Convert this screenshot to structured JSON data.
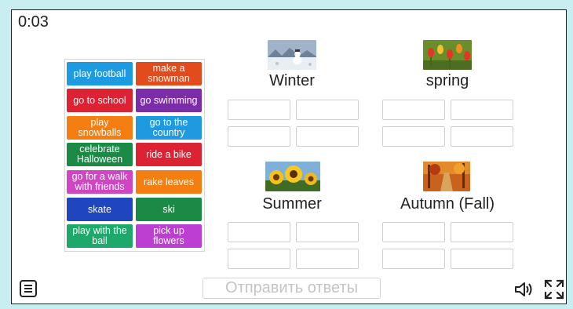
{
  "timer": "0:03",
  "cards": [
    {
      "label": "play football",
      "color": "#1e9be0"
    },
    {
      "label": "make a snowman",
      "color": "#e24b1c"
    },
    {
      "label": "go to school",
      "color": "#dc2334"
    },
    {
      "label": "go swimming",
      "color": "#7b2da8"
    },
    {
      "label": "play snowballs",
      "color": "#f57e12"
    },
    {
      "label": "go to the country",
      "color": "#1e9be0"
    },
    {
      "label": "celebrate Halloween",
      "color": "#1c8a47"
    },
    {
      "label": "ride a bike",
      "color": "#dc2334"
    },
    {
      "label": "go for a walk with friends",
      "color": "#cf45c3"
    },
    {
      "label": "rake leaves",
      "color": "#f57e12"
    },
    {
      "label": "skate",
      "color": "#2046bf"
    },
    {
      "label": "ski",
      "color": "#1c8a47"
    },
    {
      "label": "play with the ball",
      "color": "#1ea86a"
    },
    {
      "label": "pick up flowers",
      "color": "#bd3fd1"
    }
  ],
  "seasons": [
    {
      "label": "Winter",
      "image": "snowman-photo"
    },
    {
      "label": "spring",
      "image": "tulips-photo"
    },
    {
      "label": "Summer",
      "image": "sunflowers-photo"
    },
    {
      "label": "Autumn (Fall)",
      "image": "autumn-park-photo"
    }
  ],
  "submit_label": "Отправить ответы",
  "icons": {
    "menu": "menu-icon",
    "sound": "speaker-icon",
    "fullscreen": "fullscreen-icon"
  }
}
